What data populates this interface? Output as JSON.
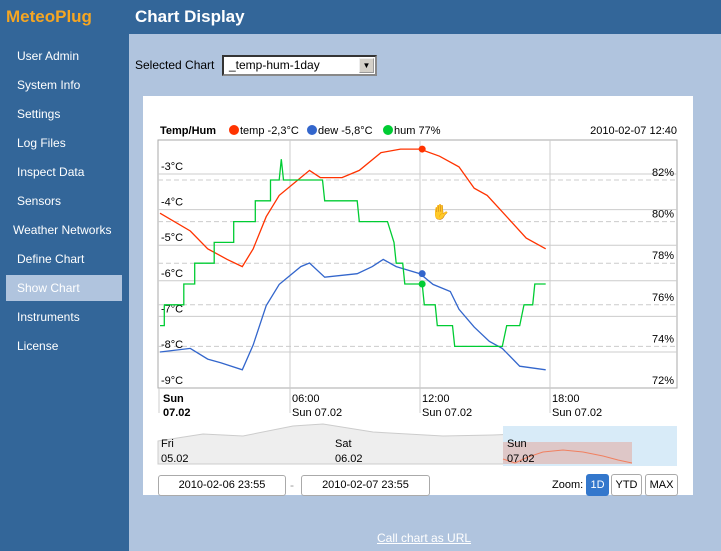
{
  "app": {
    "logo": "MeteoPlug",
    "title": "Chart Display"
  },
  "sidebar": {
    "items": [
      {
        "label": "User Admin"
      },
      {
        "label": "System Info"
      },
      {
        "label": "Settings"
      },
      {
        "label": "Log Files"
      },
      {
        "label": "Inspect Data"
      },
      {
        "label": "Sensors"
      },
      {
        "label": "Weather Networks"
      },
      {
        "label": "Define Chart"
      },
      {
        "label": "Show Chart",
        "active": true
      },
      {
        "label": "Instruments"
      },
      {
        "label": "License"
      }
    ]
  },
  "selector": {
    "label": "Selected Chart",
    "value": "_temp-hum-1day"
  },
  "chart_data": {
    "type": "line",
    "title": "Temp/Hum",
    "timestamp": "2010-02-07 12:40",
    "legend": [
      {
        "name": "temp",
        "value": "-2,3°C",
        "color": "#ff3300"
      },
      {
        "name": "dew",
        "value": "-5,8°C",
        "color": "#3366cc"
      },
      {
        "name": "hum",
        "value": "77%",
        "color": "#00cc33"
      }
    ],
    "x_ticks": [
      {
        "top": "Sun",
        "bottom": "07.02",
        "bold": true
      },
      {
        "top": "06:00",
        "bottom": "Sun 07.02"
      },
      {
        "top": "12:00",
        "bottom": "Sun 07.02"
      },
      {
        "top": "18:00",
        "bottom": "Sun 07.02"
      }
    ],
    "xlim_hours": [
      0,
      24
    ],
    "y_left": {
      "ticks": [
        "-3°C",
        "-4°C",
        "-5°C",
        "-6°C",
        "-7°C",
        "-8°C",
        "-9°C"
      ],
      "range": [
        -9,
        -2.0
      ]
    },
    "y_right": {
      "ticks": [
        "82%",
        "80%",
        "78%",
        "76%",
        "74%",
        "72%"
      ],
      "range": [
        72,
        83.9
      ]
    },
    "grid": true,
    "series": [
      {
        "name": "temp",
        "axis": "left",
        "color": "#ff3300",
        "points": [
          [
            0,
            -4.1
          ],
          [
            1.4,
            -4.6
          ],
          [
            2.2,
            -5.1
          ],
          [
            3.1,
            -5.4
          ],
          [
            3.8,
            -5.6
          ],
          [
            4.3,
            -5.1
          ],
          [
            4.9,
            -4.2
          ],
          [
            5.5,
            -3.6
          ],
          [
            6.3,
            -3.2
          ],
          [
            6.9,
            -2.9
          ],
          [
            7.4,
            -3.1
          ],
          [
            8.4,
            -3.1
          ],
          [
            9.2,
            -2.9
          ],
          [
            10.2,
            -2.4
          ],
          [
            11.1,
            -2.3
          ],
          [
            12.0,
            -2.3
          ],
          [
            12.9,
            -2.5
          ],
          [
            13.8,
            -2.8
          ],
          [
            14.5,
            -3.4
          ],
          [
            15.1,
            -3.6
          ],
          [
            15.7,
            -4.0
          ],
          [
            16.3,
            -4.4
          ],
          [
            16.9,
            -4.8
          ],
          [
            17.8,
            -5.1
          ]
        ]
      },
      {
        "name": "dew",
        "axis": "left",
        "color": "#3366cc",
        "points": [
          [
            0,
            -8.0
          ],
          [
            1.4,
            -7.9
          ],
          [
            2.2,
            -8.2
          ],
          [
            2.8,
            -8.3
          ],
          [
            3.8,
            -8.5
          ],
          [
            4.3,
            -7.8
          ],
          [
            4.9,
            -6.7
          ],
          [
            5.5,
            -6.1
          ],
          [
            6.5,
            -5.6
          ],
          [
            6.9,
            -5.5
          ],
          [
            7.6,
            -5.9
          ],
          [
            9.1,
            -5.8
          ],
          [
            9.8,
            -5.6
          ],
          [
            10.3,
            -5.4
          ],
          [
            10.9,
            -5.6
          ],
          [
            12.0,
            -5.8
          ],
          [
            12.6,
            -6.1
          ],
          [
            13.4,
            -6.3
          ],
          [
            13.8,
            -6.8
          ],
          [
            14.5,
            -7.3
          ],
          [
            15.2,
            -7.7
          ],
          [
            15.8,
            -7.9
          ],
          [
            16.6,
            -8.4
          ],
          [
            17.8,
            -8.5
          ]
        ]
      },
      {
        "name": "hum",
        "axis": "right",
        "color": "#00cc33",
        "points": [
          [
            0,
            75
          ],
          [
            0.2,
            75
          ],
          [
            0.2,
            76
          ],
          [
            1.1,
            76
          ],
          [
            1.1,
            77
          ],
          [
            1.6,
            77
          ],
          [
            1.6,
            78
          ],
          [
            2.5,
            78
          ],
          [
            2.5,
            79
          ],
          [
            3.4,
            79
          ],
          [
            3.4,
            80
          ],
          [
            4.4,
            80
          ],
          [
            4.4,
            81
          ],
          [
            5.1,
            81
          ],
          [
            5.1,
            82
          ],
          [
            5.5,
            82
          ],
          [
            5.6,
            83
          ],
          [
            5.7,
            82
          ],
          [
            7.5,
            82
          ],
          [
            7.6,
            81
          ],
          [
            9.1,
            81
          ],
          [
            9.2,
            80
          ],
          [
            10.5,
            80
          ],
          [
            10.8,
            79
          ],
          [
            10.9,
            78
          ],
          [
            11.2,
            78
          ],
          [
            11.3,
            77
          ],
          [
            12.1,
            77
          ],
          [
            12.2,
            76
          ],
          [
            12.7,
            76
          ],
          [
            12.8,
            75
          ],
          [
            13.5,
            75
          ],
          [
            13.6,
            74
          ],
          [
            15.8,
            74
          ],
          [
            16.0,
            75
          ],
          [
            16.6,
            75
          ],
          [
            16.8,
            76
          ],
          [
            17.2,
            76
          ],
          [
            17.3,
            77
          ],
          [
            17.8,
            77
          ]
        ]
      }
    ],
    "hover": {
      "hour": 12.1,
      "temp": -2.3,
      "dew": -5.8,
      "hum": 77
    },
    "navigator": {
      "labels": [
        {
          "top": "Fri",
          "bottom": "05.02"
        },
        {
          "top": "Sat",
          "bottom": "06.02"
        },
        {
          "top": "Sun",
          "bottom": "07.02"
        }
      ]
    }
  },
  "range": {
    "from": "2010-02-06 23:55",
    "separator": "-",
    "to": "2010-02-07 23:55"
  },
  "zoom": {
    "label": "Zoom:",
    "buttons": [
      {
        "label": "1D",
        "active": true
      },
      {
        "label": "YTD"
      },
      {
        "label": "MAX"
      }
    ],
    "accent": "#3377cc"
  },
  "footer": {
    "link": "Call chart as URL"
  }
}
